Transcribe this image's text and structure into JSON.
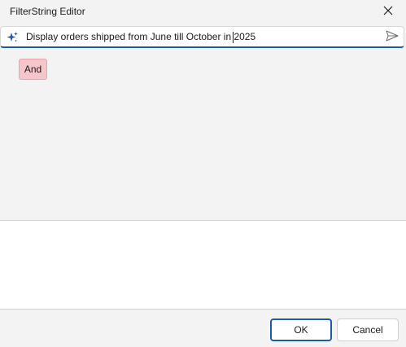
{
  "window": {
    "title": "FilterString Editor",
    "close_icon": "close-icon"
  },
  "search": {
    "value": "Display orders shipped from June till October in 2025",
    "leading_icon": "sparkle-icon",
    "trailing_icon": "send-icon",
    "accent_color": "#1e5aa8",
    "sparkle_color": "#1e5aa8"
  },
  "filter": {
    "group_operator": "And",
    "group_chip_color": "#f4c6cb"
  },
  "footer": {
    "ok_label": "OK",
    "cancel_label": "Cancel"
  }
}
